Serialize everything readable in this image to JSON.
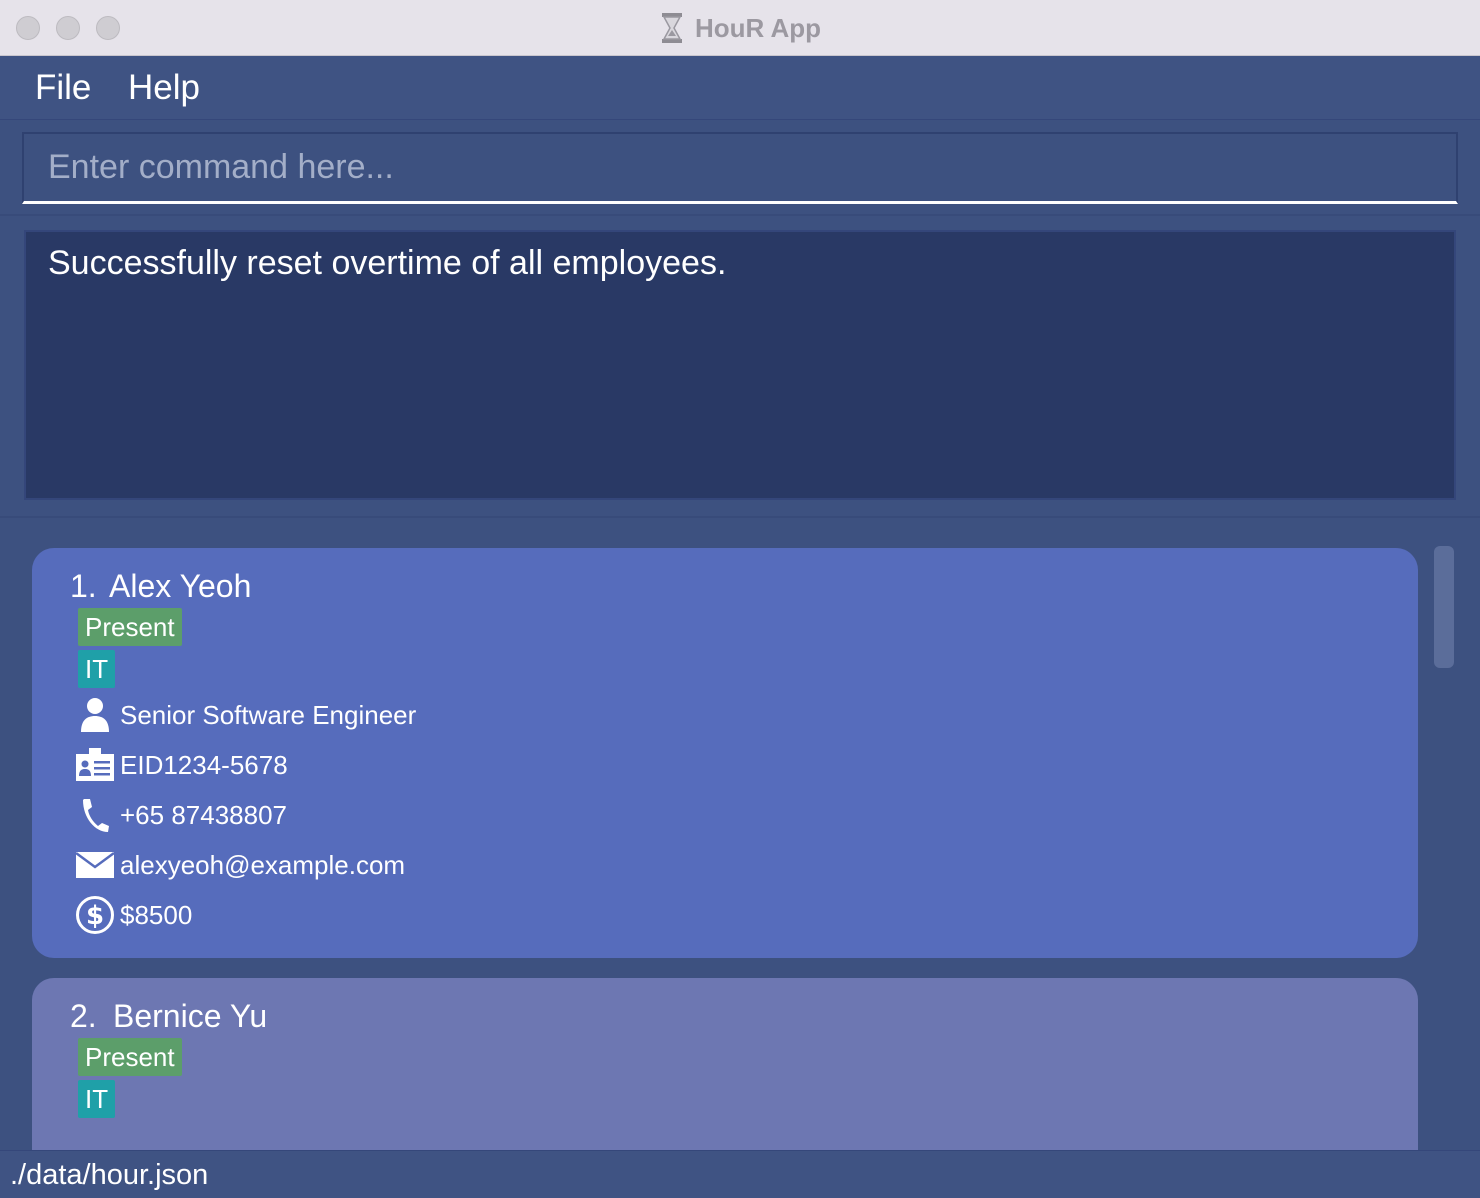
{
  "window": {
    "title": "HouR App",
    "controls": [
      "close",
      "minimize",
      "zoom"
    ]
  },
  "menu": {
    "items": [
      {
        "label": "File"
      },
      {
        "label": "Help"
      }
    ]
  },
  "command": {
    "placeholder": "Enter command here...",
    "value": ""
  },
  "result": {
    "message": "Successfully reset overtime of all employees."
  },
  "employees": [
    {
      "index": "1.",
      "name": "Alex Yeoh",
      "status": "Present",
      "department": "IT",
      "position": "Senior Software Engineer",
      "employee_id": "EID1234-5678",
      "phone": "+65 87438807",
      "email": "alexyeoh@example.com",
      "salary": "$8500",
      "selected": true
    },
    {
      "index": "2.",
      "name": "Bernice Yu",
      "status": "Present",
      "department": "IT",
      "selected": false
    }
  ],
  "status_bar": {
    "file_path": "./data/hour.json"
  },
  "colors": {
    "background": "#3d5180",
    "result_box": "#293965",
    "card_selected": "#566cbc",
    "card_default": "#6d77b2",
    "badge_present": "#5c9e6a",
    "badge_department": "#1fa0a8"
  },
  "icons": {
    "app": "hourglass-icon",
    "position": "person-icon",
    "employee_id": "id-card-icon",
    "phone": "phone-icon",
    "email": "envelope-icon",
    "salary": "dollar-circle-icon"
  }
}
